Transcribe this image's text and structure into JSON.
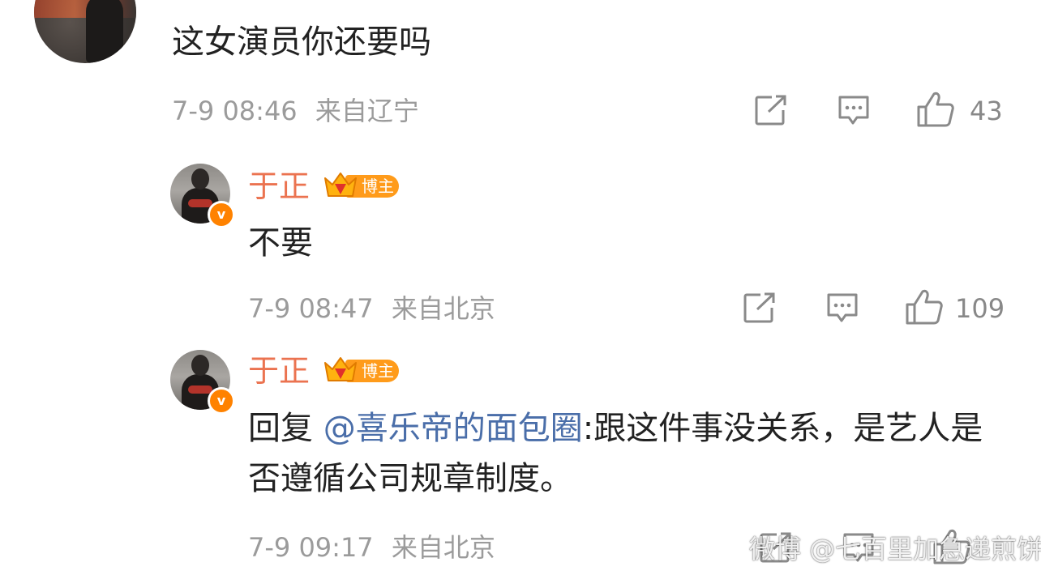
{
  "comment": {
    "text": "这女演员你还要吗",
    "time": "7-9 08:46",
    "location": "来自辽宁",
    "likes": "43"
  },
  "replies": [
    {
      "name": "于正",
      "badge": "博主",
      "text": "不要",
      "time": "7-9 08:47",
      "location": "来自北京",
      "likes": "109"
    },
    {
      "name": "于正",
      "badge": "博主",
      "prefix": "回复",
      "mention": "@喜乐帝的面包圈",
      "text": ":跟这件事没关系，是艺人是否遵循公司规章制度。",
      "time": "7-9 09:17",
      "location": "来自北京"
    }
  ],
  "watermark": "微博 @七百里加急递煎饼",
  "colors": {
    "name": "#eb7350",
    "mention": "#4a6ea9",
    "meta": "#9b9b9b",
    "verified": "#ff8200",
    "badge": "#ff9b1a"
  },
  "icons": [
    "share-icon",
    "comment-icon",
    "like-icon",
    "verified-icon",
    "crown-icon"
  ]
}
